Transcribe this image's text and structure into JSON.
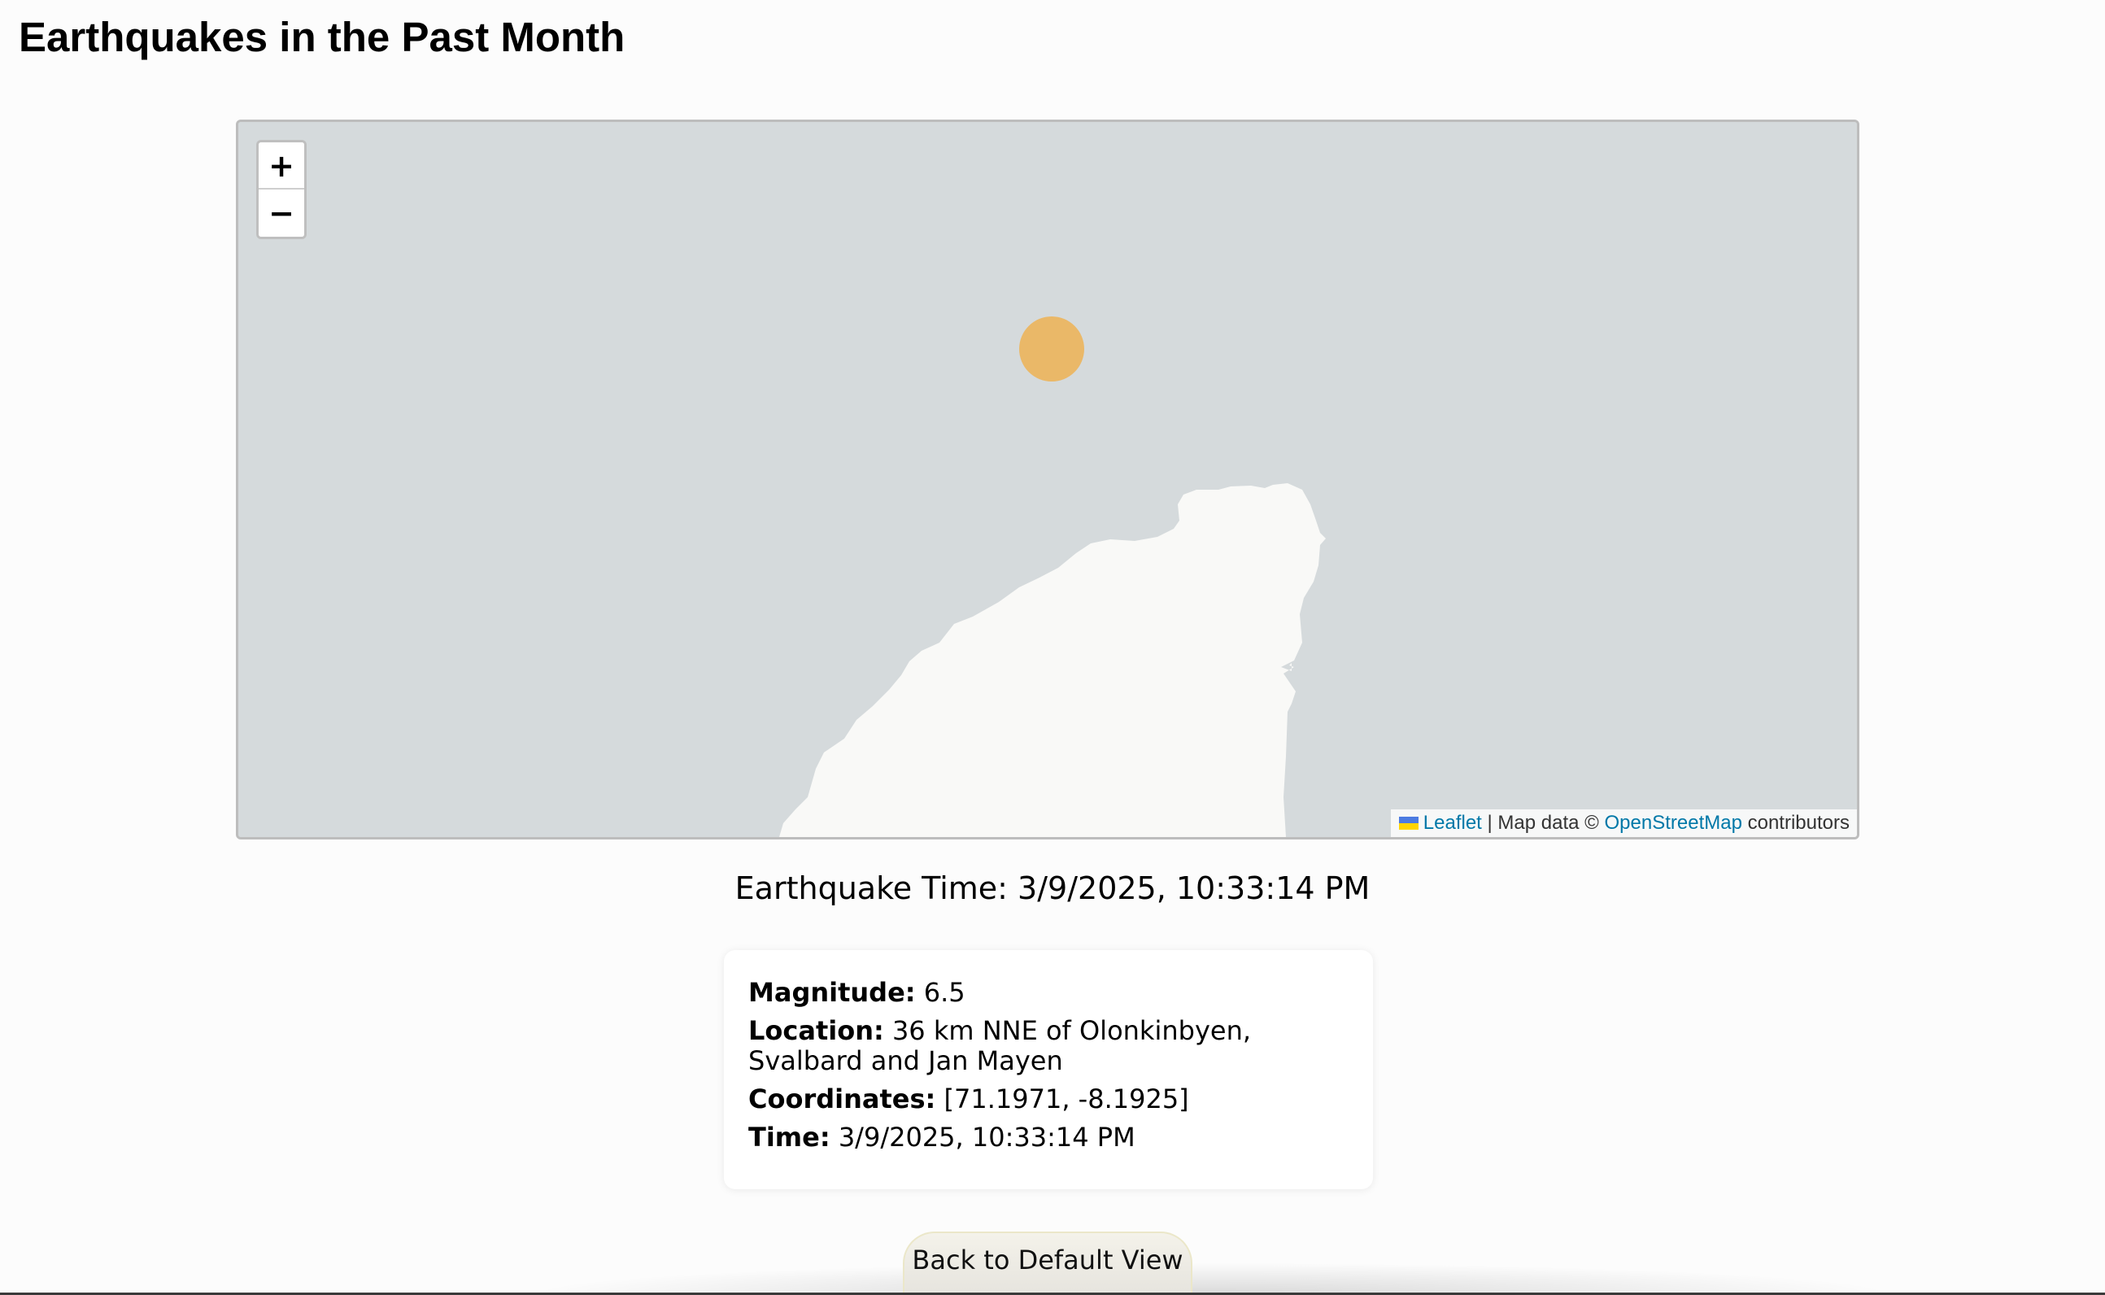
{
  "page": {
    "title": "Earthquakes in the Past Month"
  },
  "map": {
    "zoom_in_label": "+",
    "zoom_out_label": "−",
    "attribution": {
      "leaflet_link": "Leaflet",
      "separator": " | Map data © ",
      "osm_link": "OpenStreetMap",
      "suffix": " contributors"
    },
    "colors": {
      "water": "#d5dadc",
      "land": "#f9f9f7",
      "marker": "#eab868"
    },
    "marker_icon": "earthquake-circle-marker"
  },
  "quake_time": "Earthquake Time: 3/9/2025, 10:33:14 PM",
  "details": {
    "magnitude_label": "Magnitude:",
    "magnitude_value": " 6.5",
    "location_label": "Location:",
    "location_value": " 36 km NNE of Olonkinbyen, Svalbard and Jan Mayen",
    "coordinates_label": "Coordinates:",
    "coordinates_value": " [71.1971, -8.1925]",
    "time_label": "Time:",
    "time_value": " 3/9/2025, 10:33:14 PM"
  },
  "back_button_label": "Back to Default View"
}
